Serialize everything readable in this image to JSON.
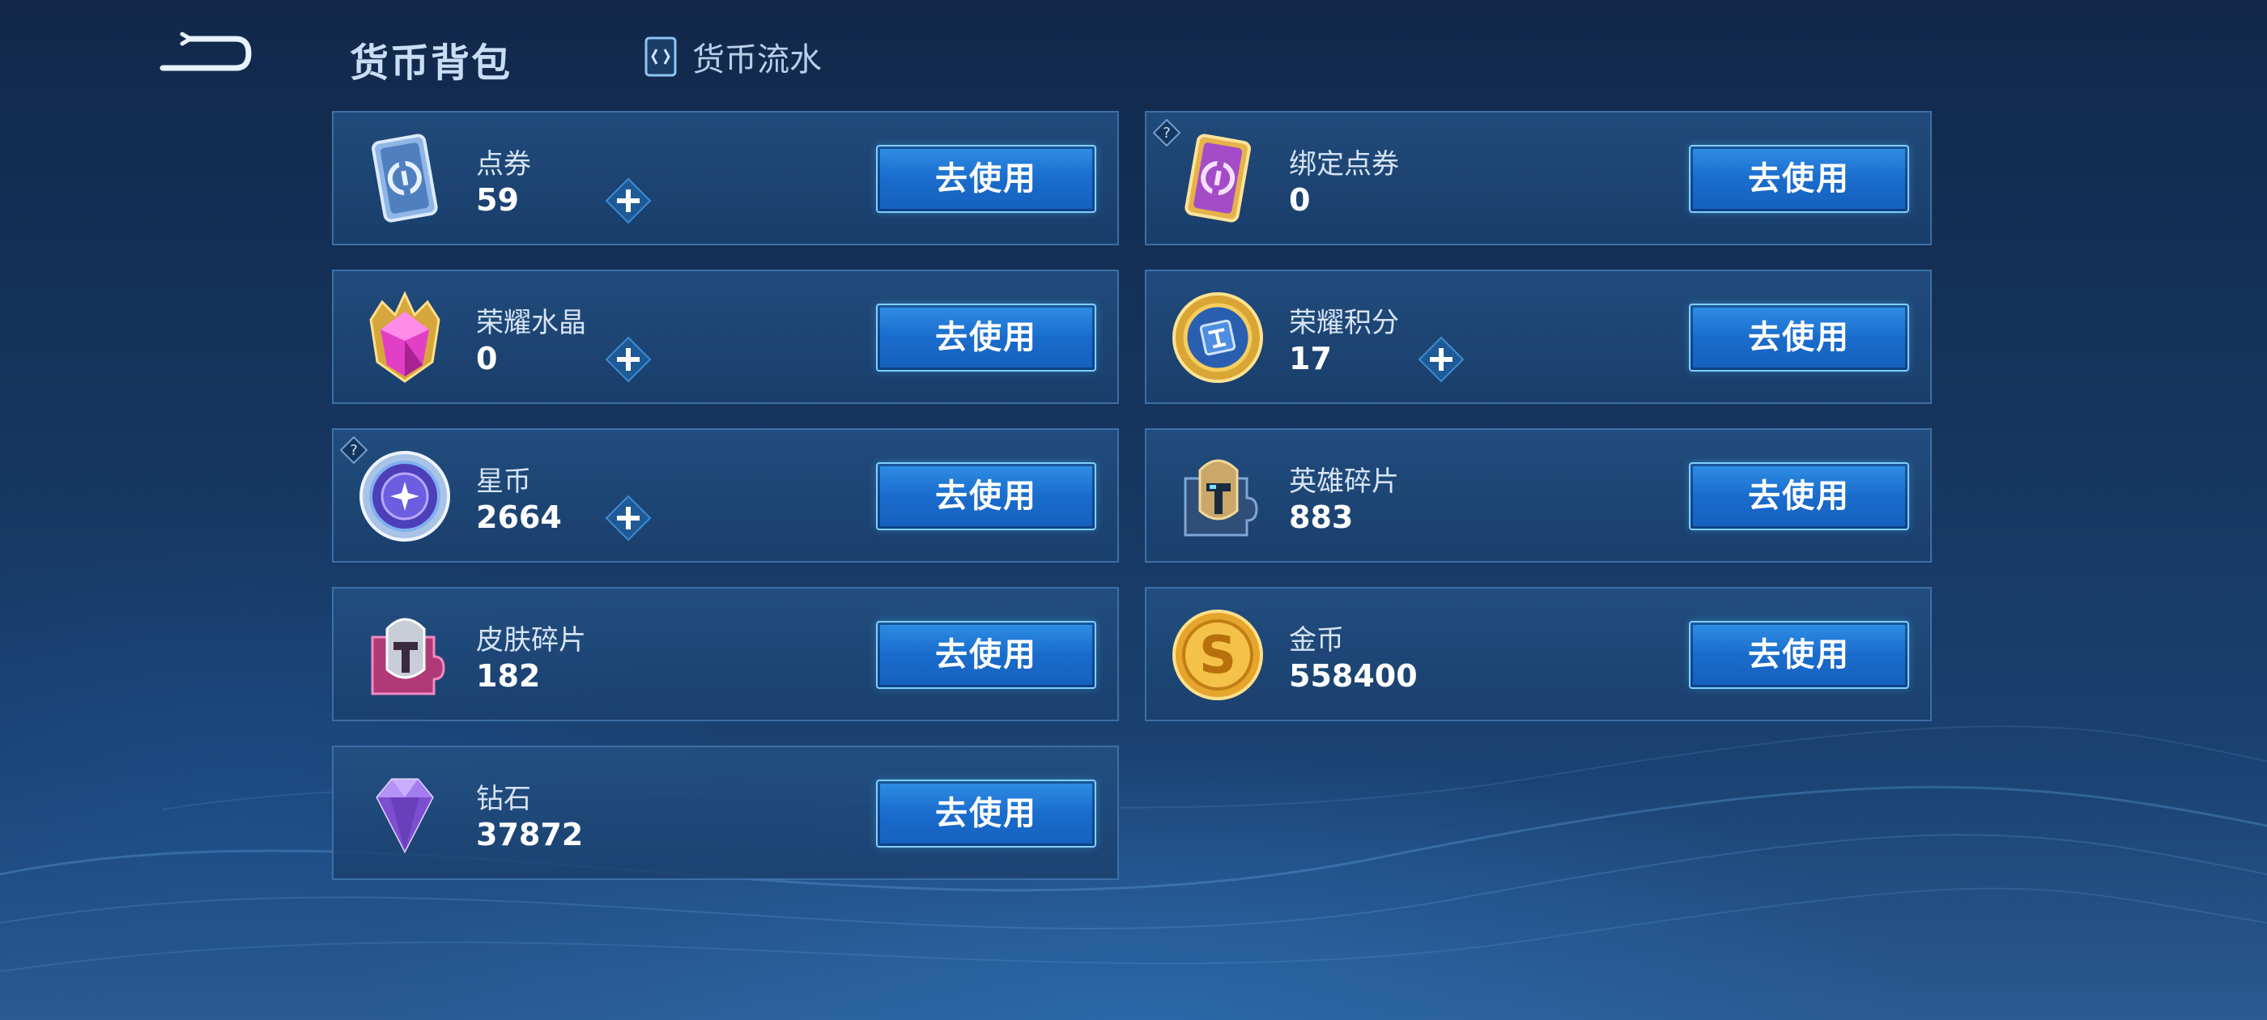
{
  "header": {
    "title": "货币背包",
    "flow_tab_label": "货币流水"
  },
  "colors": {
    "accent": "#1a6ccc",
    "button_border": "#7fd0ff",
    "card_border": "#3d6fa6",
    "background": "#163660"
  },
  "currencies": [
    {
      "name": "点券",
      "amount": "59",
      "button_label": "去使用",
      "icon": "voucher-card-icon",
      "has_plus": true,
      "has_help": false
    },
    {
      "name": "绑定点券",
      "amount": "0",
      "button_label": "去使用",
      "icon": "bound-voucher-card-icon",
      "has_plus": false,
      "has_help": true
    },
    {
      "name": "荣耀水晶",
      "amount": "0",
      "button_label": "去使用",
      "icon": "glory-crystal-icon",
      "has_plus": true,
      "has_help": false
    },
    {
      "name": "荣耀积分",
      "amount": "17",
      "button_label": "去使用",
      "icon": "glory-points-icon",
      "has_plus": true,
      "has_help": false
    },
    {
      "name": "星币",
      "amount": "2664",
      "button_label": "去使用",
      "icon": "star-coin-icon",
      "has_plus": true,
      "has_help": true
    },
    {
      "name": "英雄碎片",
      "amount": "883",
      "button_label": "去使用",
      "icon": "hero-fragment-icon",
      "has_plus": false,
      "has_help": false
    },
    {
      "name": "皮肤碎片",
      "amount": "182",
      "button_label": "去使用",
      "icon": "skin-fragment-icon",
      "has_plus": false,
      "has_help": false
    },
    {
      "name": "金币",
      "amount": "558400",
      "button_label": "去使用",
      "icon": "gold-coin-icon",
      "has_plus": false,
      "has_help": false
    },
    {
      "name": "钻石",
      "amount": "37872",
      "button_label": "去使用",
      "icon": "diamond-icon",
      "has_plus": false,
      "has_help": false
    }
  ]
}
